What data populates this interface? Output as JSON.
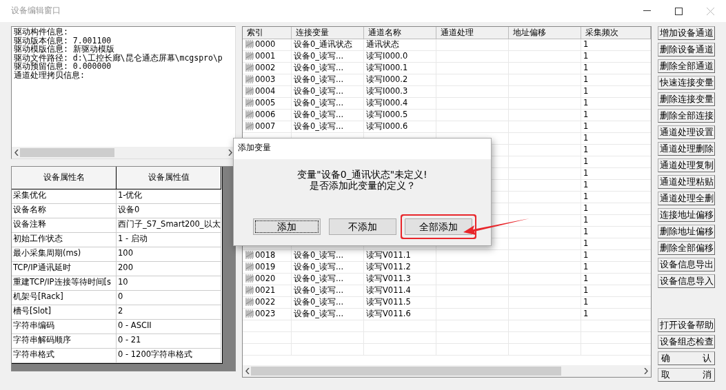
{
  "window": {
    "title": "设备编辑窗口"
  },
  "driver_info": {
    "lines": [
      "驱动构件信息:",
      "驱动版本信息: 7.001100",
      "驱动模版信息: 新驱动模版",
      "驱动文件路径: d:\\工控长廊\\昆仑通态屏幕\\mcgspro\\p",
      "驱动预留信息: 0.000000",
      "通道处理拷贝信息:"
    ]
  },
  "properties": {
    "columns": [
      "设备属性名",
      "设备属性值"
    ],
    "rows": [
      {
        "name": "采集优化",
        "value": "1-优化"
      },
      {
        "name": "设备名称",
        "value": "设备0"
      },
      {
        "name": "设备注释",
        "value": "西门子_S7_Smart200_以太"
      },
      {
        "name": "初始工作状态",
        "value": "1 - 启动"
      },
      {
        "name": "最小采集周期(ms)",
        "value": "100"
      },
      {
        "name": "TCP/IP通讯延时",
        "value": "200"
      },
      {
        "name": "重建TCP/IP连接等待时间[s",
        "value": "10"
      },
      {
        "name": "机架号[Rack]",
        "value": "0"
      },
      {
        "name": "槽号[Slot]",
        "value": "2"
      },
      {
        "name": "字符串编码",
        "value": "0 - ASCII"
      },
      {
        "name": "字符串解码顺序",
        "value": "0 - 21"
      },
      {
        "name": "字符串格式",
        "value": "0 - 1200字符串格式"
      }
    ]
  },
  "channels": {
    "columns": [
      "索引",
      "连接变量",
      "通道名称",
      "通道处理",
      "地址偏移",
      "采集频次"
    ],
    "rows": [
      {
        "index": "0000",
        "variable": "设备0_通讯状态",
        "name": "通讯状态",
        "frequency": "1"
      },
      {
        "index": "0001",
        "variable": "设备0_读写...",
        "name": "读写I000.0",
        "frequency": "1"
      },
      {
        "index": "0002",
        "variable": "设备0_读写...",
        "name": "读写I000.1",
        "frequency": "1"
      },
      {
        "index": "0003",
        "variable": "设备0_读写...",
        "name": "读写I000.2",
        "frequency": "1"
      },
      {
        "index": "0004",
        "variable": "设备0_读写...",
        "name": "读写I000.3",
        "frequency": "1"
      },
      {
        "index": "0005",
        "variable": "设备0_读写...",
        "name": "读写I000.4",
        "frequency": "1"
      },
      {
        "index": "0006",
        "variable": "设备0_读写...",
        "name": "读写I000.5",
        "frequency": "1"
      },
      {
        "index": "0007",
        "variable": "设备0_读写...",
        "name": "读写I000.6",
        "frequency": "1"
      },
      {
        "frequency": "1"
      },
      {
        "frequency": "1"
      },
      {
        "frequency": "1"
      },
      {
        "frequency": "1"
      },
      {
        "frequency": "1"
      },
      {
        "frequency": "1"
      },
      {
        "frequency": "1"
      },
      {
        "frequency": "1"
      },
      {
        "frequency": "1"
      },
      {
        "frequency": "1"
      },
      {
        "index": "0018",
        "variable": "设备0_读写...",
        "name": "读写V011.1",
        "frequency": "1"
      },
      {
        "index": "0019",
        "variable": "设备0_读写...",
        "name": "读写V011.2",
        "frequency": "1"
      },
      {
        "index": "0020",
        "variable": "设备0_读写...",
        "name": "读写V011.3",
        "frequency": "1"
      },
      {
        "index": "0021",
        "variable": "设备0_读写...",
        "name": "读写V011.4",
        "frequency": "1"
      },
      {
        "index": "0022",
        "variable": "设备0_读写...",
        "name": "读写V011.5",
        "frequency": "1"
      },
      {
        "index": "0023",
        "variable": "设备0_读写...",
        "name": "读写V011.6",
        "frequency": "1"
      }
    ]
  },
  "side_buttons": [
    "增加设备通道",
    "删除设备通道",
    "删除全部通道",
    "快速连接变量",
    "删除连接变量",
    "删除全部连接",
    "通道处理设置",
    "通道处理删除",
    "通道处理复制",
    "通道处理粘贴",
    "通道处理全删",
    "连接地址偏移",
    "删除地址偏移",
    "删除全部偏移",
    "设备信息导出",
    "设备信息导入",
    "打开设备帮助",
    "设备组态检查",
    "确 认",
    "取 消"
  ],
  "dialog": {
    "title": "添加变量",
    "message": [
      "变量\"设备0_通讯状态\"未定义!",
      "是否添加此变量的定义？"
    ],
    "buttons": [
      {
        "label": "添加",
        "focused": true,
        "highlighted": false
      },
      {
        "label": "不添加",
        "focused": false,
        "highlighted": false
      },
      {
        "label": "全部添加",
        "focused": false,
        "highlighted": true
      }
    ]
  }
}
